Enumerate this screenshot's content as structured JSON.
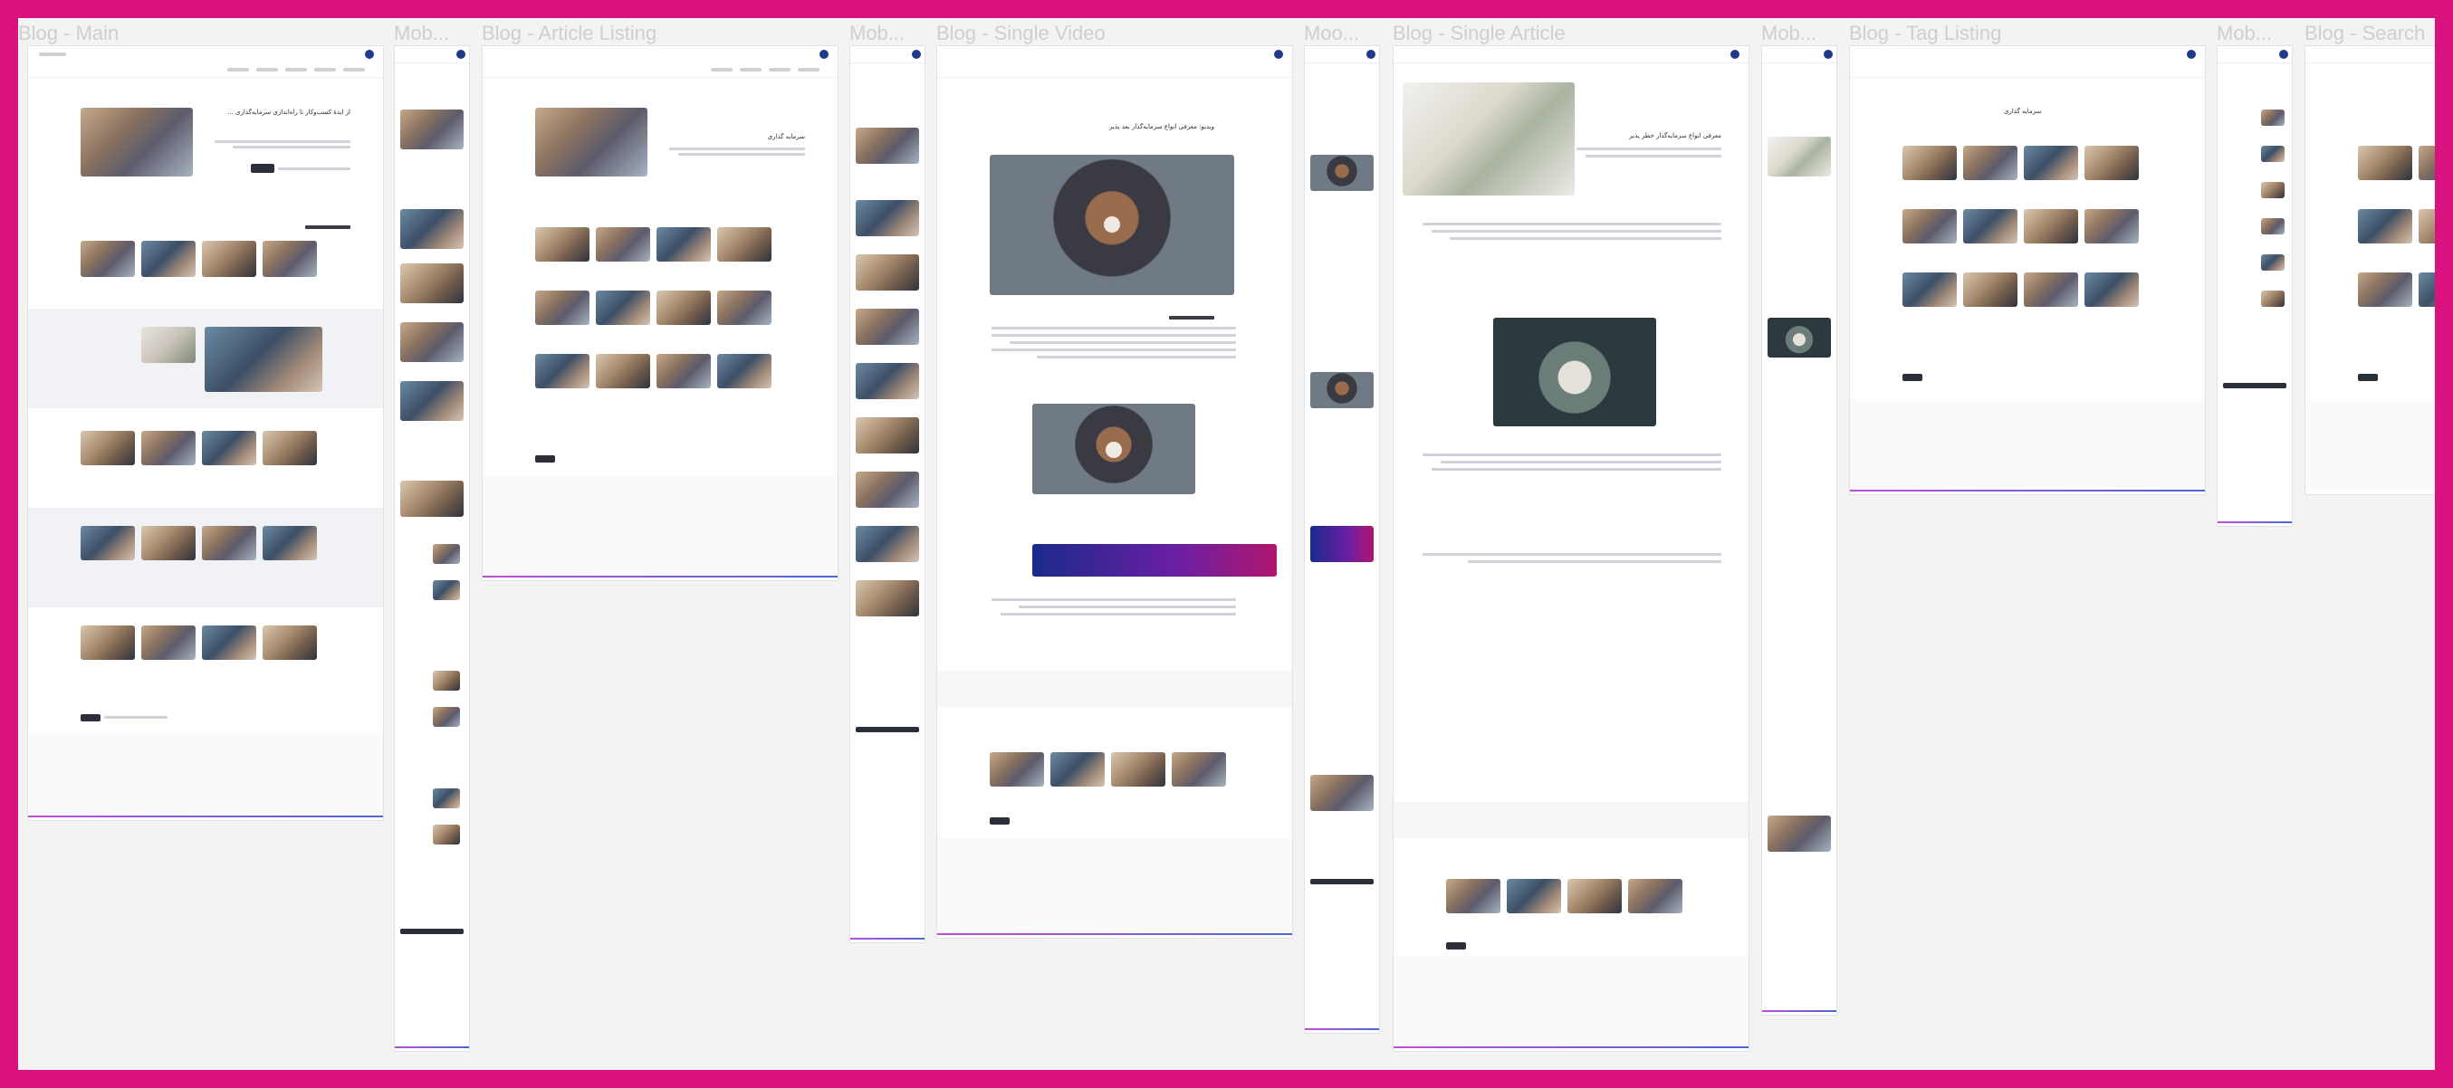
{
  "canvas": {
    "background": "#f3f3f3",
    "border_color": "#d9127f"
  },
  "frames": [
    {
      "id": "blog-main",
      "title": "Blog - Main"
    },
    {
      "id": "mobile-1",
      "title": "Mob..."
    },
    {
      "id": "blog-article-listing",
      "title": "Blog - Article Listing"
    },
    {
      "id": "mobile-2",
      "title": "Mob..."
    },
    {
      "id": "blog-single-video",
      "title": "Blog - Single Video"
    },
    {
      "id": "mobile-3",
      "title": "Moo..."
    },
    {
      "id": "blog-single-article",
      "title": "Blog - Single Article"
    },
    {
      "id": "mobile-4",
      "title": "Mob..."
    },
    {
      "id": "blog-tag-listing",
      "title": "Blog - Tag Listing"
    },
    {
      "id": "mobile-5",
      "title": "Mob..."
    },
    {
      "id": "blog-search",
      "title": "Blog - Search"
    }
  ],
  "page_text": {
    "article_listing_heading": "سرمایه گذاری",
    "single_video_heading": "ویدیو: معرفی انواع سرمایه‌گذار بعد پذیر",
    "single_article_heading": "معرفی انواع سرمایه‌گذار خطر پذیر",
    "tag_listing_heading": "سرمایه گذاری",
    "main_hero_heading": "از ایدهٔ کسب‌وکار تا راه‌اندازی سرمایه‌گذاری ..."
  },
  "colors": {
    "brand": "#1e3a8a",
    "accent_gradient_start": "#c04fd6",
    "accent_gradient_end": "#4a67d6",
    "banner_start": "#1b2a8c",
    "banner_end": "#b0166e"
  }
}
